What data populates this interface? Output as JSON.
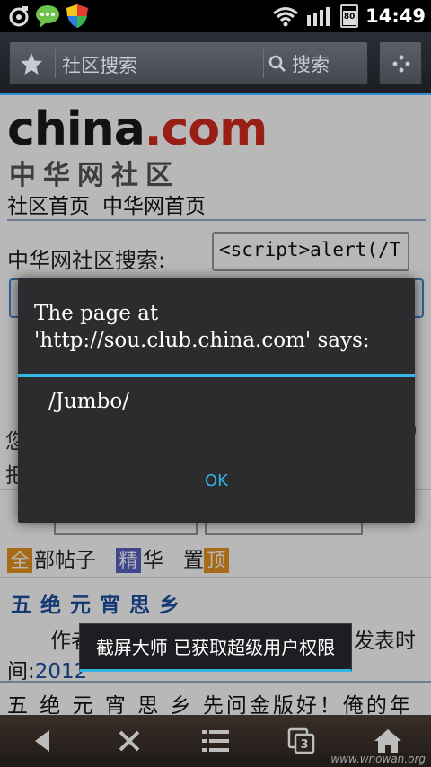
{
  "status_bar": {
    "time": "14:49",
    "battery_level": "80",
    "icons": [
      "screen-capture-icon",
      "chat-bubble-icon",
      "shield-icon",
      "wifi-icon",
      "signal-icon",
      "battery-icon"
    ]
  },
  "browser": {
    "address_text": "社区搜索",
    "search_label": "搜索"
  },
  "page": {
    "logo_text": "china.com",
    "logo_main": "china",
    "logo_dot": ".",
    "logo_suffix": "com",
    "logo_cn": "中华网社区",
    "nav_links": [
      "社区首页",
      "中华网首页"
    ],
    "search_label": "中华网社区搜索:",
    "search_value": "<script>alert(/T",
    "behind_text_1": "您",
    "behind_text_2": "把",
    "behind_text_right": ")",
    "tabs": [
      {
        "badge": "全",
        "label": "部帖子",
        "badge_color": "#e8931f"
      },
      {
        "badge": "精",
        "label": "华",
        "badge_color": "#5b63c5"
      },
      {
        "pre": "置",
        "badge": "顶",
        "badge_color": "#e8931f"
      }
    ],
    "post_title": "五绝元宵思乡",
    "author_prefix": "作者",
    "pubtime_label": "发表时",
    "time_prefix": "间:",
    "time_value": "2012",
    "body_line": "五 绝 元 宵 思 乡 先问金版好！俺的年"
  },
  "dialog": {
    "title": "The page at 'http://sou.club.china.com' says:",
    "message": "/Jumbo/",
    "ok_label": "OK"
  },
  "toast": {
    "text": "截屏大师 已获取超级用户权限"
  },
  "bottom_bar": {
    "buttons": [
      "back-icon",
      "close-icon",
      "menu-list-icon",
      "tabs-icon",
      "home-icon"
    ],
    "tab_count": "3"
  },
  "watermark": "www.wnowan.org",
  "colors": {
    "accent": "#33b5e5",
    "brand_red": "#d42a1f",
    "link_blue": "#1e4fa3"
  }
}
